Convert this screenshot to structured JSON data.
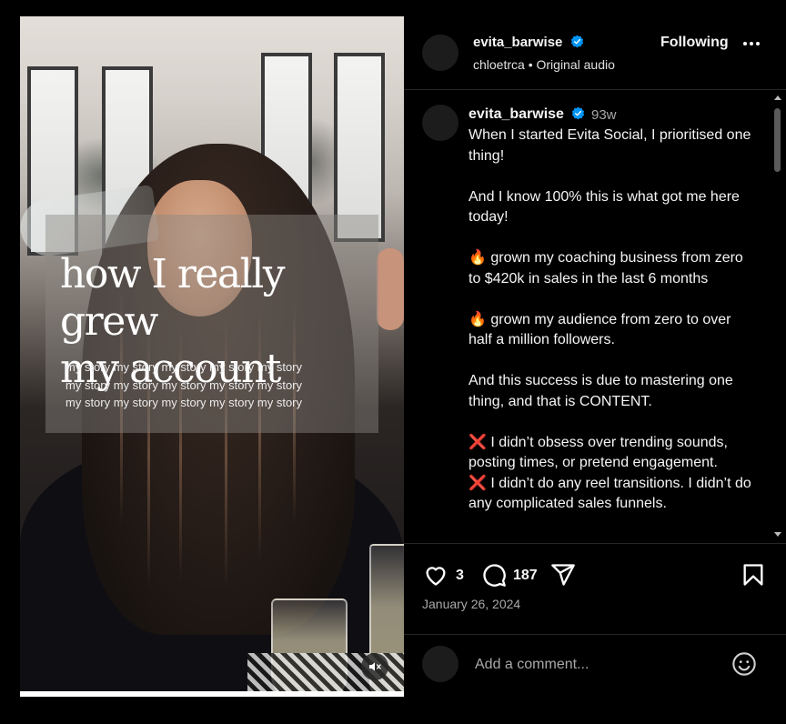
{
  "post": {
    "media": {
      "headline_line1": "how I really grew",
      "headline_line2": "my account",
      "story_lines": [
        "my story my story my story my story my story",
        "my story my story my story my story my story",
        "my story my story my story my story my story"
      ],
      "mute_icon": "speaker-muted-icon"
    },
    "header": {
      "username": "evita_barwise",
      "audio_user": "chloetrca",
      "audio_separator": " • ",
      "audio_label": "Original audio",
      "follow_label": "Following",
      "more_icon": "more-options-icon"
    },
    "caption": {
      "username": "evita_barwise",
      "age": "93w",
      "paragraphs": [
        "When I started Evita Social, I prioritised one thing!",
        "And I know 100% this is what got me here today!",
        "🔥 grown my coaching business from zero to $420k in sales in the last 6 months",
        "🔥 grown my audience  from zero to over half a million followers.",
        "And this success is due to mastering one thing, and that is CONTENT.",
        "❌ I didn’t obsess over trending sounds, posting times, or pretend engagement.",
        "❌ I didn’t do any reel transitions. I didn’t do any complicated sales funnels."
      ]
    },
    "actions": {
      "like_count": "3",
      "comment_count": "187",
      "date": "January 26, 2024"
    },
    "comment": {
      "placeholder": "Add a comment...",
      "emoji_icon": "emoji-icon"
    },
    "colors": {
      "background": "#000000",
      "verified": "#0095f6",
      "secondary_text": "#a8a8a8",
      "divider": "#262626"
    }
  }
}
